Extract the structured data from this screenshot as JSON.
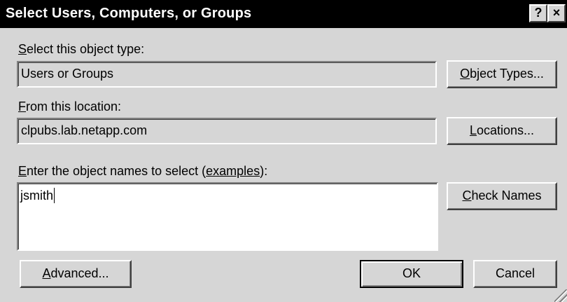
{
  "window": {
    "title": "Select Users, Computers, or Groups",
    "help_label": "?",
    "close_label": "×"
  },
  "object_type": {
    "label_prefix": "S",
    "label_rest": "elect this object type:",
    "value": "Users or Groups",
    "button_prefix": "O",
    "button_rest": "bject Types..."
  },
  "location": {
    "label_prefix": "F",
    "label_rest": "rom this location:",
    "value": "clpubs.lab.netapp.com",
    "button_prefix": "L",
    "button_rest": "ocations..."
  },
  "names": {
    "label_prefix": "E",
    "label_rest": "nter the object names to select (",
    "link_text": "examples",
    "label_suffix": "):",
    "value": "jsmith",
    "check_prefix": "C",
    "check_rest": "heck Names"
  },
  "buttons": {
    "advanced_prefix": "A",
    "advanced_rest": "dvanced...",
    "ok": "OK",
    "cancel": "Cancel"
  }
}
